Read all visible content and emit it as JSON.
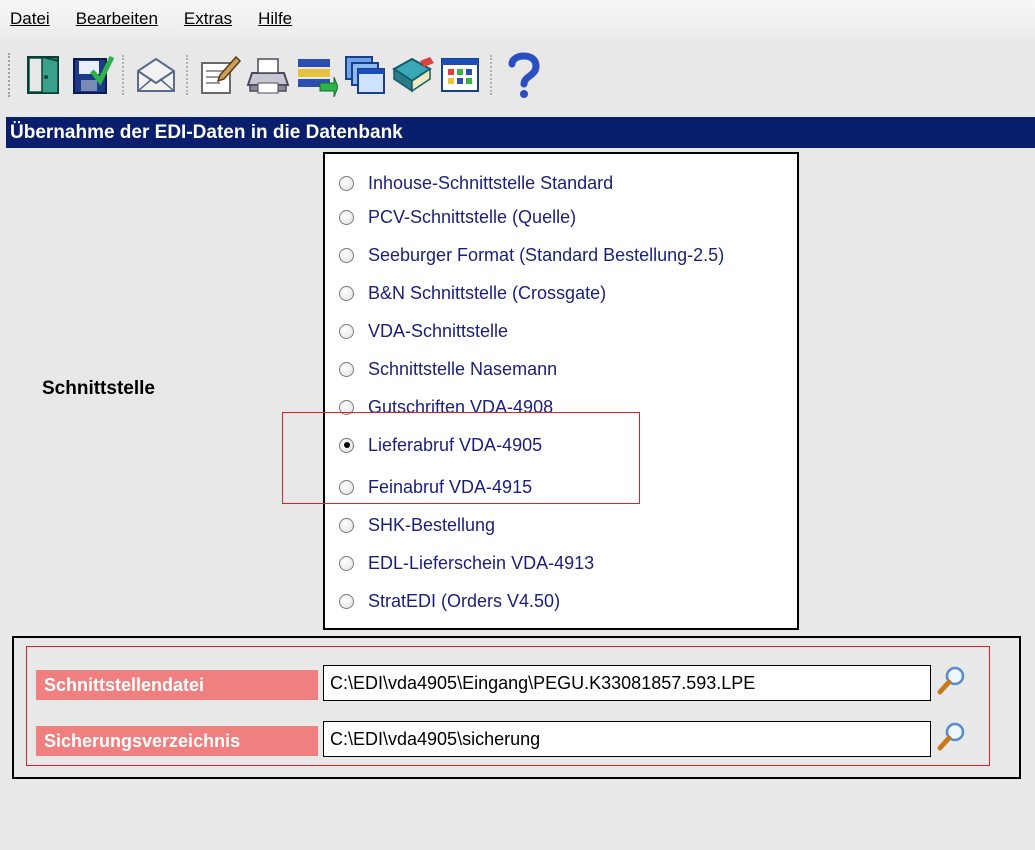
{
  "menubar": {
    "items": [
      {
        "label": "Datei"
      },
      {
        "label": "Bearbeiten"
      },
      {
        "label": "Extras"
      },
      {
        "label": "Hilfe"
      }
    ]
  },
  "toolbar": {
    "buttons": [
      {
        "icon": "exit-door-icon"
      },
      {
        "icon": "save-check-icon"
      },
      {
        "icon": "envelope-icon"
      },
      {
        "icon": "edit-note-icon"
      },
      {
        "icon": "printer-icon"
      },
      {
        "icon": "transfer-list-icon"
      },
      {
        "icon": "window-stack-icon"
      },
      {
        "icon": "book-icon"
      },
      {
        "icon": "grid-window-icon"
      },
      {
        "icon": "help-icon"
      }
    ]
  },
  "section": {
    "title": "Übernahme der EDI-Daten in die Datenbank"
  },
  "schnittstelle": {
    "label": "Schnittstelle",
    "options": [
      {
        "label": "Inhouse-Schnittstelle Standard",
        "checked": false
      },
      {
        "label": "PCV-Schnittstelle (Quelle)",
        "checked": false
      },
      {
        "label": "Seeburger Format (Standard Bestellung-2.5)",
        "checked": false
      },
      {
        "label": "B&N Schnittstelle (Crossgate)",
        "checked": false
      },
      {
        "label": "VDA-Schnittstelle",
        "checked": false
      },
      {
        "label": "Schnittstelle Nasemann",
        "checked": false
      },
      {
        "label": "Gutschriften VDA-4908",
        "checked": false
      },
      {
        "label": "Lieferabruf VDA-4905",
        "checked": true
      },
      {
        "label": "Feinabruf VDA-4915",
        "checked": false
      },
      {
        "label": "SHK-Bestellung",
        "checked": false
      },
      {
        "label": "EDL-Lieferschein VDA-4913",
        "checked": false
      },
      {
        "label": "StratEDI (Orders V4.50)",
        "checked": false
      }
    ]
  },
  "files": {
    "schnittstellendatei": {
      "label": "Schnittstellendatei",
      "value": "C:\\EDI\\vda4905\\Eingang\\PEGU.K33081857.593.LPE"
    },
    "sicherungsverzeichnis": {
      "label": "Sicherungsverzeichnis",
      "value": "C:\\EDI\\vda4905\\sicherung"
    }
  },
  "colors": {
    "header_bg": "#0a1e6e",
    "radio_text": "#1a1f7a",
    "file_label_bg": "#f08080",
    "highlight": "#e0202a"
  }
}
